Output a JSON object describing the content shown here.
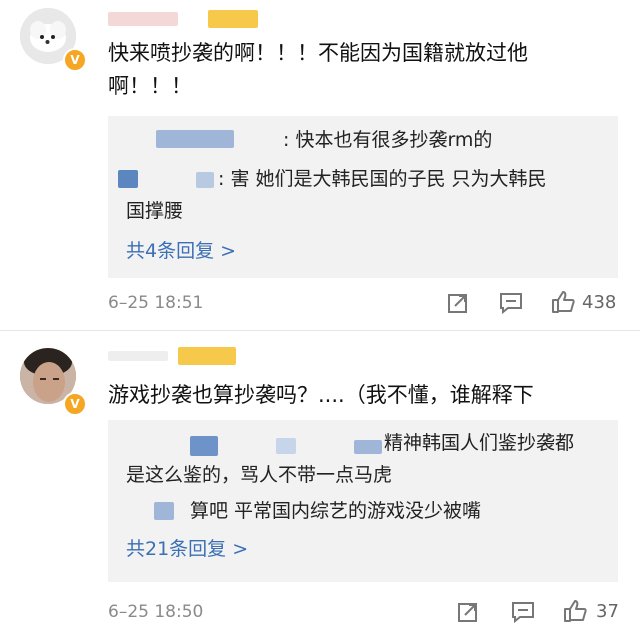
{
  "comments": [
    {
      "text_line1": "快来喷抄袭的啊！！！不能因为国籍就放过他",
      "text_line2": "啊！！！",
      "replies": [
        {
          "text": ": 快本也有很多抄袭rm的"
        },
        {
          "text": ": 害 她们是大韩民国的子民 只为大韩民"
        },
        {
          "text": "国撑腰"
        }
      ],
      "more_replies": "共4条回复 >",
      "time": "6–25 18:51",
      "likes": "438"
    },
    {
      "text_line1": "游戏抄袭也算抄袭吗？....（我不懂，谁解释下",
      "replies": [
        {
          "text": "精神韩国人们鉴抄袭都"
        },
        {
          "text": "是这么鉴的，骂人不带一点马虎"
        },
        {
          "text": "算吧 平常国内综艺的游戏没少被嘴"
        }
      ],
      "more_replies": "共21条回复 >",
      "time": "6–25 18:50",
      "likes": "37"
    }
  ],
  "icons": {
    "share": "share-icon",
    "comment": "comment-icon",
    "like": "thumb-up-icon",
    "verified": "verified-badge-icon"
  },
  "colors": {
    "link": "#3b6fb6",
    "verified": "#f5a623",
    "reply_bg": "#f2f2f2"
  }
}
